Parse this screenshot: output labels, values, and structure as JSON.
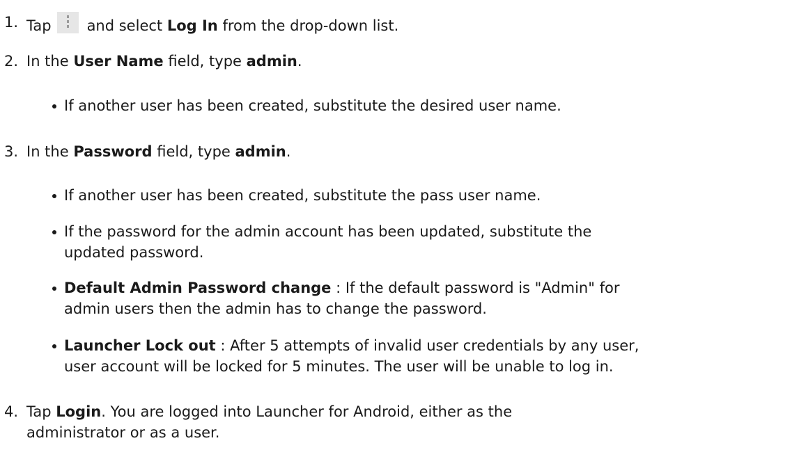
{
  "steps": [
    {
      "number": "1.",
      "pre": "Tap",
      "icon": "overflow-menu-icon",
      "mid": "and select",
      "bold": "Log In",
      "post": "from the drop-down list."
    },
    {
      "number": "2.",
      "pre": "In the",
      "bold1": "User Name",
      "mid": "field, type",
      "bold2": "admin",
      "post": ".",
      "bullets": [
        "If another user has been created, substitute the desired user name."
      ]
    },
    {
      "number": "3.",
      "pre": "In the",
      "bold1": "Password",
      "mid": "field, type",
      "bold2": "admin",
      "post": ".",
      "bullets": [
        {
          "text": "If another user has been created, substitute the pass user name."
        },
        {
          "line1": "If the password for the admin account has been updated, substitute the",
          "line2": "updated password."
        },
        {
          "bold": "Default Admin Password change",
          "line1": " : If the default password is \"Admin\" for",
          "line2": "admin users then the admin has to change the password."
        },
        {
          "bold": "Launcher Lock out",
          "line1": " : After 5 attempts of invalid user credentials by any user,",
          "line2": "user account will be locked for 5 minutes. The user will be unable to log in."
        }
      ]
    },
    {
      "number": "4.",
      "pre": "Tap",
      "bold": "Login",
      "line1": ". You are logged into Launcher for Android, either as the",
      "line2": "administrator or as a user."
    }
  ]
}
